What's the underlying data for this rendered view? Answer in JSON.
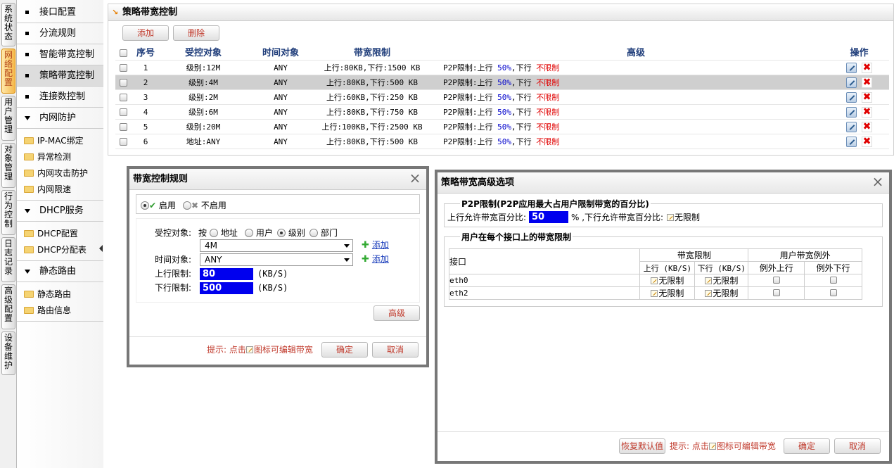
{
  "vtabs": [
    "系统状态",
    "网络配置",
    "用户管理",
    "对象管理",
    "行为控制",
    "日志记录",
    "高级配置",
    "设备维护"
  ],
  "sidebar": {
    "items": [
      "接口配置",
      "分流规则",
      "智能带宽控制",
      "策略带宽控制",
      "连接数控制"
    ],
    "groups": [
      {
        "title": "内网防护",
        "items": [
          "IP-MAC绑定",
          "异常检测",
          "内网攻击防护",
          "内网限速"
        ]
      },
      {
        "title": "DHCP服务",
        "items": [
          "DHCP配置",
          "DHCP分配表"
        ]
      },
      {
        "title": "静态路由",
        "items": [
          "静态路由",
          "路由信息"
        ]
      }
    ]
  },
  "main": {
    "title": "策略带宽控制",
    "add": "添加",
    "delete": "删除",
    "headers": [
      "序号",
      "受控对象",
      "时间对象",
      "带宽限制",
      "高级",
      "操作"
    ],
    "rows": [
      {
        "no": "1",
        "obj": "级别:12M",
        "time": "ANY",
        "bw": "上行:80KB,下行:1500 KB",
        "p2p": "P2P限制:上行 ",
        "pct": "50%",
        "mid": ",下行 ",
        "unl": "不限制"
      },
      {
        "no": "2",
        "obj": "级别:4M",
        "time": "ANY",
        "bw": "上行:80KB,下行:500 KB",
        "p2p": "P2P限制:上行 ",
        "pct": "50%",
        "mid": ",下行 ",
        "unl": "不限制"
      },
      {
        "no": "3",
        "obj": "级别:2M",
        "time": "ANY",
        "bw": "上行:60KB,下行:250 KB",
        "p2p": "P2P限制:上行 ",
        "pct": "50%",
        "mid": ",下行 ",
        "unl": "不限制"
      },
      {
        "no": "4",
        "obj": "级别:6M",
        "time": "ANY",
        "bw": "上行:80KB,下行:750 KB",
        "p2p": "P2P限制:上行 ",
        "pct": "50%",
        "mid": ",下行 ",
        "unl": "不限制"
      },
      {
        "no": "5",
        "obj": "级别:20M",
        "time": "ANY",
        "bw": "上行:100KB,下行:2500 KB",
        "p2p": "P2P限制:上行 ",
        "pct": "50%",
        "mid": ",下行 ",
        "unl": "不限制"
      },
      {
        "no": "6",
        "obj": "地址:ANY",
        "time": "ANY",
        "bw": "上行:80KB,下行:500 KB",
        "p2p": "P2P限制:上行 ",
        "pct": "50%",
        "mid": ",下行 ",
        "unl": "不限制"
      }
    ]
  },
  "rule_dialog": {
    "title": "带宽控制规则",
    "enable": "启用",
    "disable": "不启用",
    "obj_label": "受控对象:",
    "by": "按",
    "obj_opts": [
      "地址",
      "用户",
      "级别",
      "部门"
    ],
    "obj_value": "4M",
    "time_label": "时间对象:",
    "time_value": "ANY",
    "add_link": "添加",
    "up_label": "上行限制:",
    "up_value": "80",
    "down_label": "下行限制:",
    "down_value": "500",
    "unit": "(KB/S)",
    "advanced": "高级",
    "hint_a": "提示: 点击",
    "hint_b": "图标可编辑带宽",
    "ok": "确定",
    "cancel": "取消"
  },
  "adv_dialog": {
    "title": "策略带宽高级选项",
    "p2p_legend": "P2P限制(P2P应用最大占用户限制带宽的百分比)",
    "up_pct_label": "上行允许带宽百分比:",
    "up_pct_value": "50",
    "down_pct_label": "% ,下行允许带宽百分比:",
    "unlimited": "无限制",
    "iface_legend": "用户在每个接口上的带宽限制",
    "col_iface": "接口",
    "col_bw": "带宽限制",
    "col_exc": "用户带宽例外",
    "col_up": "上行 (KB/S)",
    "col_down": "下行 (KB/S)",
    "col_exc_up": "例外上行",
    "col_exc_down": "例外下行",
    "ifaces": [
      "eth0",
      "eth2"
    ],
    "restore": "恢复默认值",
    "hint_a": "提示: 点击",
    "hint_b": "图标可编辑带宽",
    "ok": "确定",
    "cancel": "取消"
  }
}
